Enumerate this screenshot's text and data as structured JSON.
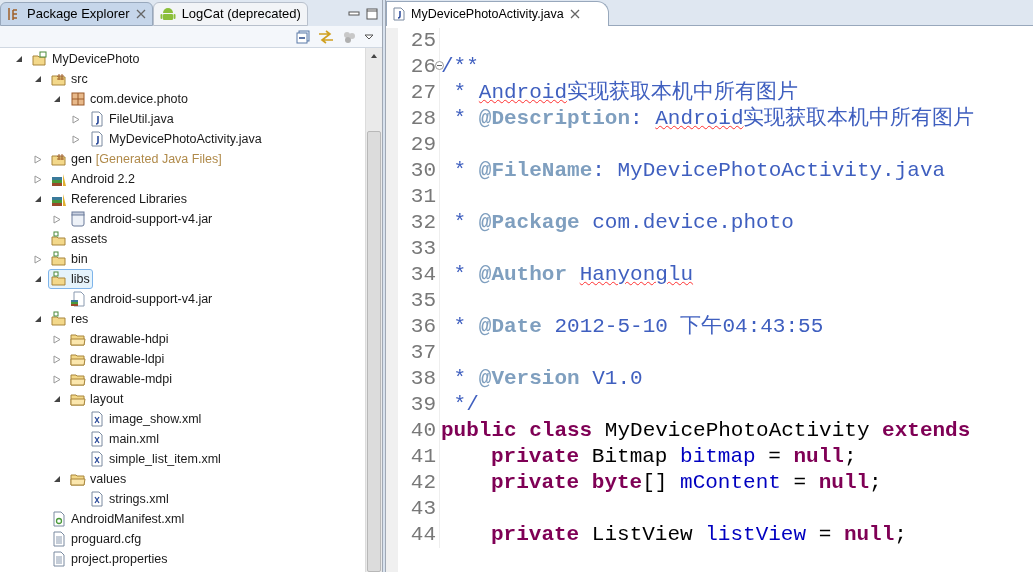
{
  "left_panel": {
    "tabs": [
      {
        "label": "Package Explorer",
        "kind": "explorer",
        "selected": true,
        "closable": true
      },
      {
        "label": "LogCat (deprecated)",
        "kind": "android",
        "selected": false,
        "closable": false
      }
    ],
    "tree": [
      {
        "label": "MyDevicePhoto",
        "kind": "project",
        "expanded": true,
        "selected": false,
        "children": [
          {
            "label": "src",
            "kind": "srcfolder",
            "expanded": true,
            "selected": false,
            "children": [
              {
                "label": "com.device.photo",
                "kind": "package",
                "expanded": true,
                "selected": false,
                "children": [
                  {
                    "label": "FileUtil.java",
                    "kind": "java",
                    "expanded": false,
                    "selected": false
                  },
                  {
                    "label": "MyDevicePhotoActivity.java",
                    "kind": "java",
                    "expanded": false,
                    "selected": false
                  }
                ]
              }
            ]
          },
          {
            "label": "gen",
            "note": "[Generated Java Files]",
            "kind": "srcfolder",
            "expanded": false,
            "selected": false
          },
          {
            "label": "Android 2.2",
            "kind": "library",
            "expanded": false,
            "selected": false
          },
          {
            "label": "Referenced Libraries",
            "kind": "library",
            "expanded": true,
            "selected": false,
            "children": [
              {
                "label": "android-support-v4.jar",
                "kind": "jar",
                "expanded": false,
                "selected": false
              }
            ]
          },
          {
            "label": "assets",
            "kind": "resfolder",
            "selected": false
          },
          {
            "label": "bin",
            "kind": "resfolder",
            "expanded": false,
            "selected": false
          },
          {
            "label": "libs",
            "kind": "resfolder",
            "expanded": true,
            "selected": true,
            "children": [
              {
                "label": "android-support-v4.jar",
                "kind": "jarfile",
                "selected": false
              }
            ]
          },
          {
            "label": "res",
            "kind": "resfolder",
            "expanded": true,
            "selected": false,
            "children": [
              {
                "label": "drawable-hdpi",
                "kind": "folder",
                "expanded": false,
                "selected": false
              },
              {
                "label": "drawable-ldpi",
                "kind": "folder",
                "expanded": false,
                "selected": false
              },
              {
                "label": "drawable-mdpi",
                "kind": "folder",
                "expanded": false,
                "selected": false
              },
              {
                "label": "layout",
                "kind": "folder",
                "expanded": true,
                "selected": false,
                "children": [
                  {
                    "label": "image_show.xml",
                    "kind": "xml",
                    "selected": false
                  },
                  {
                    "label": "main.xml",
                    "kind": "xml",
                    "selected": false
                  },
                  {
                    "label": "simple_list_item.xml",
                    "kind": "xml",
                    "selected": false
                  }
                ]
              },
              {
                "label": "values",
                "kind": "folder",
                "expanded": true,
                "selected": false,
                "children": [
                  {
                    "label": "strings.xml",
                    "kind": "xml",
                    "selected": false
                  }
                ]
              }
            ]
          },
          {
            "label": "AndroidManifest.xml",
            "kind": "manifest",
            "selected": false
          },
          {
            "label": "proguard.cfg",
            "kind": "text",
            "selected": false
          },
          {
            "label": "project.properties",
            "kind": "text",
            "selected": false
          }
        ]
      }
    ]
  },
  "editor": {
    "tabs": [
      {
        "label": "MyDevicePhotoActivity.java",
        "selected": true
      }
    ],
    "lines": [
      {
        "number": "25"
      },
      {
        "number": "26",
        "fold_marker": true,
        "tokens": [
          {
            "kind": "comment",
            "text": "/**"
          }
        ]
      },
      {
        "number": "27",
        "tokens": [
          {
            "kind": "comment",
            "text": " * "
          },
          {
            "kind": "misspelled",
            "text": "Android"
          },
          {
            "kind": "comment",
            "text": "实现获取本机中所有图片"
          }
        ]
      },
      {
        "number": "28",
        "tokens": [
          {
            "kind": "comment",
            "text": " * "
          },
          {
            "kind": "tag",
            "text": "@Description"
          },
          {
            "kind": "comment",
            "text": ": "
          },
          {
            "kind": "misspelled",
            "text": "Android"
          },
          {
            "kind": "comment",
            "text": "实现获取本机中所有图片"
          }
        ]
      },
      {
        "number": "29"
      },
      {
        "number": "30",
        "tokens": [
          {
            "kind": "comment",
            "text": " * "
          },
          {
            "kind": "tag",
            "text": "@FileName"
          },
          {
            "kind": "comment",
            "text": ": MyDevicePhotoActivity.java"
          }
        ]
      },
      {
        "number": "31"
      },
      {
        "number": "32",
        "tokens": [
          {
            "kind": "comment",
            "text": " * "
          },
          {
            "kind": "tag",
            "text": "@Package"
          },
          {
            "kind": "comment",
            "text": " com.device.photo"
          }
        ]
      },
      {
        "number": "33"
      },
      {
        "number": "34",
        "tokens": [
          {
            "kind": "comment",
            "text": " * "
          },
          {
            "kind": "tag",
            "text": "@Author"
          },
          {
            "kind": "misspelled",
            "text": " Hanyonglu"
          }
        ]
      },
      {
        "number": "35"
      },
      {
        "number": "36",
        "tokens": [
          {
            "kind": "comment",
            "text": " * "
          },
          {
            "kind": "tag",
            "text": "@Date"
          },
          {
            "kind": "comment",
            "text": " 2012-5-10 下午04:43:55"
          }
        ]
      },
      {
        "number": "37"
      },
      {
        "number": "38",
        "tokens": [
          {
            "kind": "comment",
            "text": " * "
          },
          {
            "kind": "tag",
            "text": "@Version"
          },
          {
            "kind": "comment",
            "text": " V1.0"
          }
        ]
      },
      {
        "number": "39",
        "tokens": [
          {
            "kind": "comment",
            "text": " */"
          }
        ]
      },
      {
        "number": "40",
        "tokens": [
          {
            "kind": "keyword",
            "text": "public class"
          },
          {
            "kind": "plain",
            "text": " MyDevicePhotoActivity "
          },
          {
            "kind": "keyword",
            "text": "extends"
          }
        ]
      },
      {
        "number": "41",
        "indented": true,
        "tokens": [
          {
            "kind": "keyword",
            "text": "private"
          },
          {
            "kind": "plain",
            "text": " Bitmap "
          },
          {
            "kind": "field",
            "text": "bitmap"
          },
          {
            "kind": "plain",
            "text": " = "
          },
          {
            "kind": "keyword",
            "text": "null"
          },
          {
            "kind": "plain",
            "text": ";"
          }
        ]
      },
      {
        "number": "42",
        "indented": true,
        "tokens": [
          {
            "kind": "keyword",
            "text": "private byte"
          },
          {
            "kind": "plain",
            "text": "[] "
          },
          {
            "kind": "field",
            "text": "mContent"
          },
          {
            "kind": "plain",
            "text": " = "
          },
          {
            "kind": "keyword",
            "text": "null"
          },
          {
            "kind": "plain",
            "text": ";"
          }
        ]
      },
      {
        "number": "43"
      },
      {
        "number": "44",
        "indented": true,
        "tokens": [
          {
            "kind": "keyword",
            "text": "private"
          },
          {
            "kind": "plain",
            "text": " ListView "
          },
          {
            "kind": "field",
            "text": "listView"
          },
          {
            "kind": "plain",
            "text": " = "
          },
          {
            "kind": "keyword",
            "text": "null"
          },
          {
            "kind": "plain",
            "text": ";"
          }
        ]
      }
    ]
  }
}
